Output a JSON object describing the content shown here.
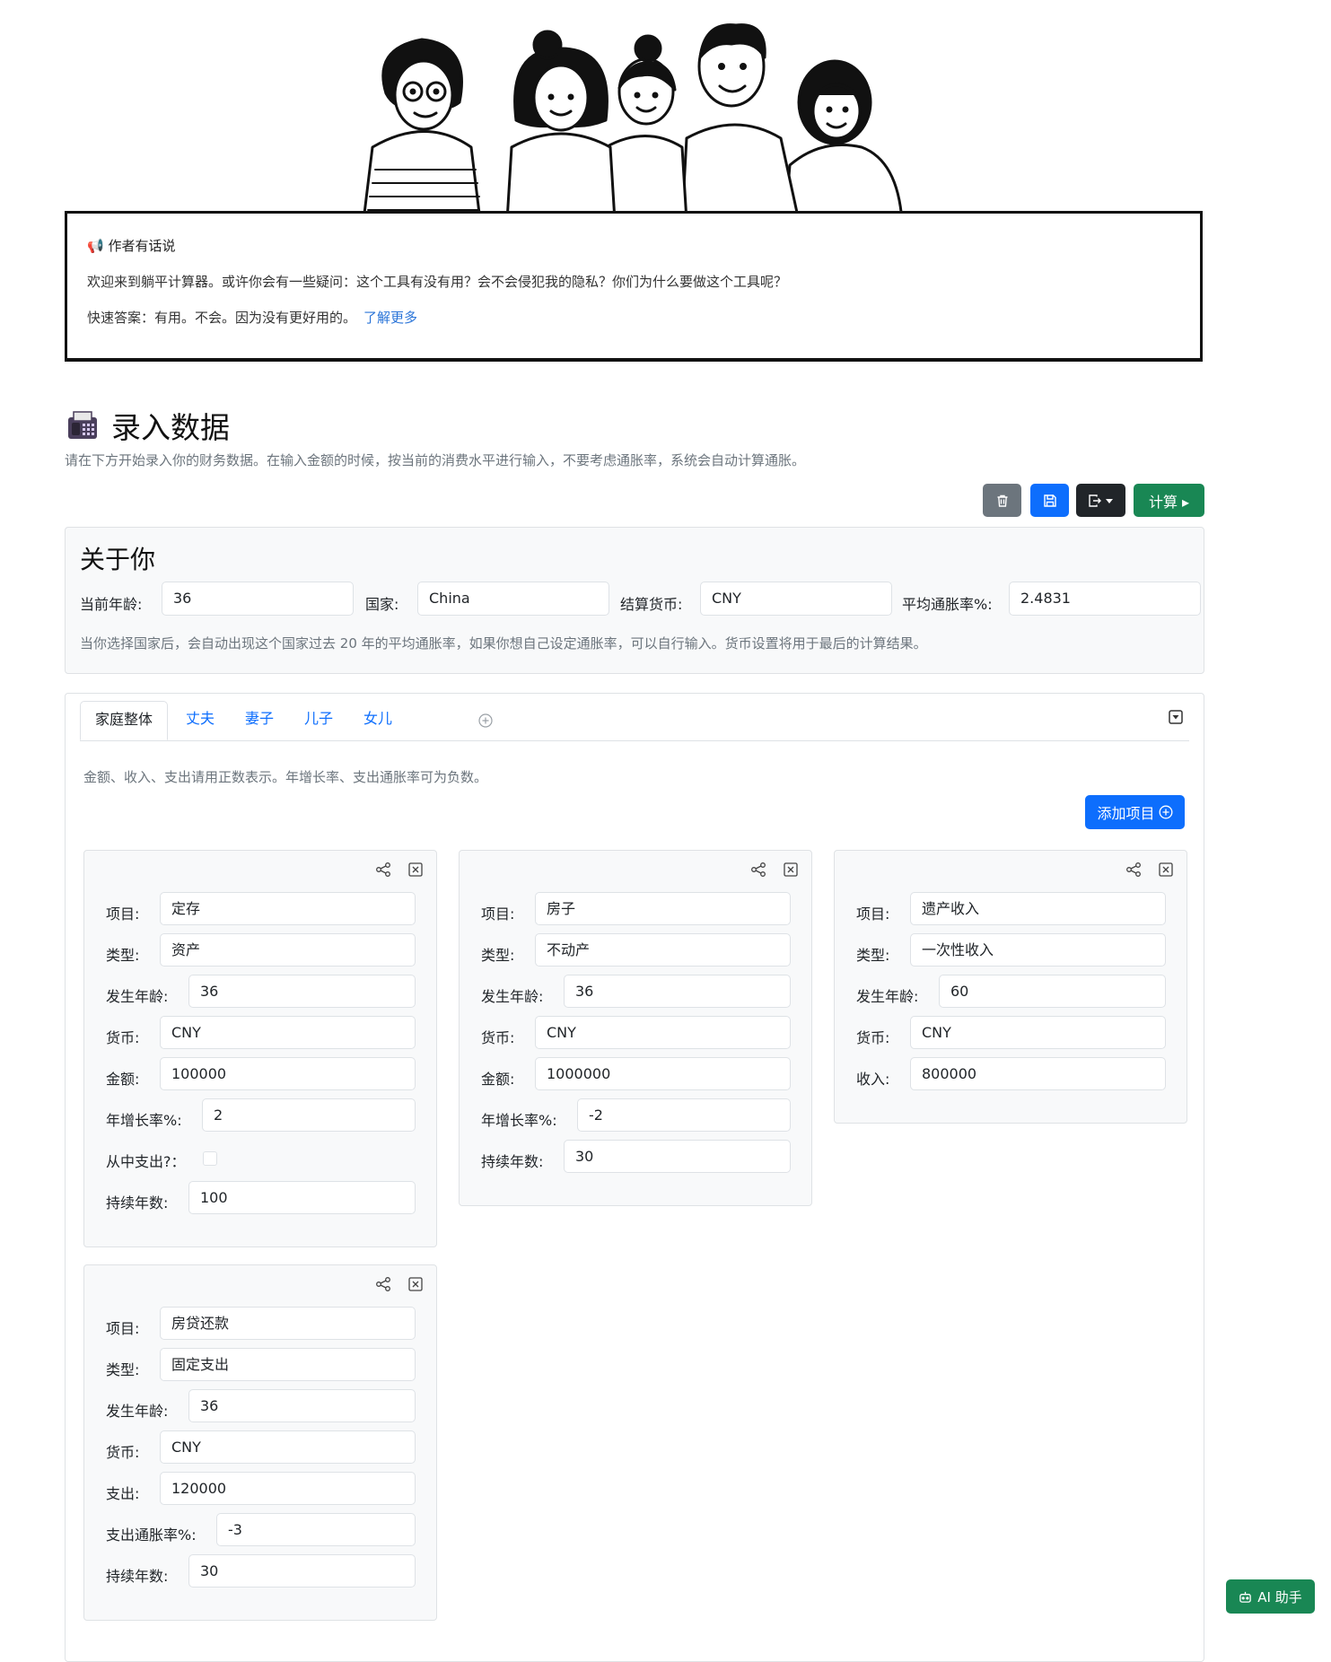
{
  "author_note": {
    "title": "作者有话说",
    "line1": "欢迎来到躺平计算器。或许你会有一些疑问：这个工具有没有用？会不会侵犯我的隐私？你们为什么要做这个工具呢？",
    "line2": "快速答案：有用。不会。因为没有更好用的。",
    "link": "了解更多"
  },
  "section": {
    "title": "录入数据",
    "subtitle": "请在下方开始录入你的财务数据。在输入金额的时候，按当前的消费水平进行输入，不要考虑通胀率，系统会自动计算通胀。"
  },
  "toolbar": {
    "calc_label": "计算 ▸"
  },
  "about": {
    "title": "关于你",
    "age_label": "当前年龄:",
    "age_value": "36",
    "country_label": "国家:",
    "country_value": "China",
    "currency_label": "结算货币:",
    "currency_value": "CNY",
    "inflation_label": "平均通胀率%:",
    "inflation_value": "2.4831",
    "note": "当你选择国家后，会自动出现这个国家过去 20 年的平均通胀率，如果你想自己设定通胀率，可以自行输入。货币设置将用于最后的计算结果。"
  },
  "tabs": [
    "家庭整体",
    "丈夫",
    "妻子",
    "儿子",
    "女儿"
  ],
  "family": {
    "hint": "金额、收入、支出请用正数表示。年增长率、支出通胀率可为负数。",
    "add_label": "添加项目"
  },
  "cards": [
    {
      "fields": [
        {
          "label": "项目:",
          "value": "定存"
        },
        {
          "label": "类型:",
          "value": "资产"
        },
        {
          "label": "发生年龄:",
          "value": "36"
        },
        {
          "label": "货币:",
          "value": "CNY"
        },
        {
          "label": "金额:",
          "value": "100000"
        },
        {
          "label": "年增长率%:",
          "value": "2"
        },
        {
          "label": "从中支出?：",
          "value": ""
        },
        {
          "label": "持续年数:",
          "value": "100"
        }
      ]
    },
    {
      "fields": [
        {
          "label": "项目:",
          "value": "房子"
        },
        {
          "label": "类型:",
          "value": "不动产"
        },
        {
          "label": "发生年龄:",
          "value": "36"
        },
        {
          "label": "货币:",
          "value": "CNY"
        },
        {
          "label": "金额:",
          "value": "1000000"
        },
        {
          "label": "年增长率%:",
          "value": "-2"
        },
        {
          "label": "持续年数:",
          "value": "30"
        }
      ]
    },
    {
      "fields": [
        {
          "label": "项目:",
          "value": "遗产收入"
        },
        {
          "label": "类型:",
          "value": "一次性收入"
        },
        {
          "label": "发生年龄:",
          "value": "60"
        },
        {
          "label": "货币:",
          "value": "CNY"
        },
        {
          "label": "收入:",
          "value": "800000"
        }
      ]
    },
    {
      "fields": [
        {
          "label": "项目:",
          "value": "房贷还款"
        },
        {
          "label": "类型:",
          "value": "固定支出"
        },
        {
          "label": "发生年龄:",
          "value": "36"
        },
        {
          "label": "货币:",
          "value": "CNY"
        },
        {
          "label": "支出:",
          "value": "120000"
        },
        {
          "label": "支出通胀率%:",
          "value": "-3"
        },
        {
          "label": "持续年数:",
          "value": "30"
        }
      ]
    }
  ],
  "ai": {
    "label": "AI 助手"
  },
  "colors": {
    "primary": "#0d6efd",
    "success": "#198754",
    "secondary": "#6c757d",
    "dark": "#212529"
  }
}
